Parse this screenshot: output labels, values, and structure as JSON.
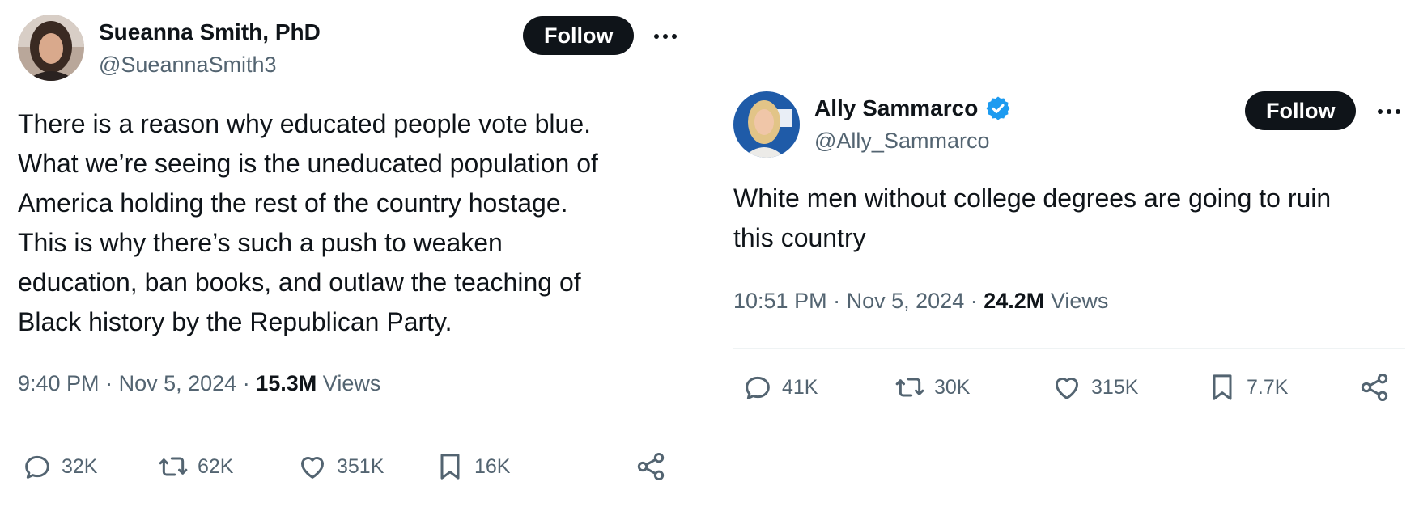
{
  "tweets": [
    {
      "display_name": "Sueanna Smith, PhD",
      "handle": "@SueannaSmith3",
      "verified": false,
      "follow_label": "Follow",
      "text": "There is a reason why educated people vote blue.\nWhat we’re seeing is the uneducated population of\nAmerica holding the rest of the country hostage.\nThis is why there’s such a push to weaken\neducation, ban books, and outlaw the teaching of\nBlack history by the Republican Party.",
      "time": "9:40 PM",
      "date": "Nov 5, 2024",
      "views_count": "15.3M",
      "views_label": "Views",
      "replies": "32K",
      "reposts": "62K",
      "likes": "351K",
      "bookmarks": "16K"
    },
    {
      "display_name": "Ally Sammarco",
      "handle": "@Ally_Sammarco",
      "verified": true,
      "follow_label": "Follow",
      "text": "White men without college degrees are going to ruin\nthis country",
      "time": "10:51 PM",
      "date": "Nov 5, 2024",
      "views_count": "24.2M",
      "views_label": "Views",
      "replies": "41K",
      "reposts": "30K",
      "likes": "315K",
      "bookmarks": "7.7K"
    }
  ],
  "separator": "·",
  "icons": [
    "reply-icon",
    "repost-icon",
    "like-icon",
    "bookmark-icon",
    "share-icon",
    "more-icon",
    "verified-badge-icon"
  ],
  "colors": {
    "text": "#0f1419",
    "muted": "#536471",
    "follow_bg": "#0f1419",
    "verified_blue": "#1d9bf0",
    "divider": "#eff3f4"
  }
}
